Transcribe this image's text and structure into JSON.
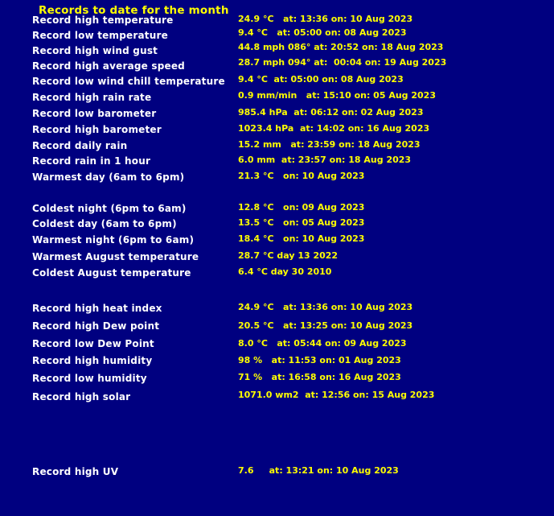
{
  "page": {
    "title": "Records to date for the month",
    "background_color": "#000080",
    "label_color": "#ffffff",
    "value_color": "#ffff00"
  },
  "records": [
    {
      "label": "Record high temperature",
      "value": "24.9 °C   at: 13:36 on: 10 Aug 2023"
    },
    {
      "label": "Record low temperature",
      "value": "9.4 °C   at: 05:00 on: 08 Aug 2023"
    },
    {
      "label": "Record high wind gust",
      "value": "44.8 mph 086° at: 20:52 on: 18 Aug 2023"
    },
    {
      "label": "Record high average speed",
      "value": "28.7 mph 094° at:  00:04 on: 19 Aug 2023"
    },
    {
      "label": "Record low wind chill temperature",
      "value": "9.4 °C  at: 05:00 on: 08 Aug 2023"
    },
    {
      "label": "Record high rain rate",
      "value": "0.9 mm/min   at: 15:10 on: 05 Aug 2023"
    },
    {
      "label": "Record low barometer",
      "value": "985.4 hPa  at: 06:12 on: 02 Aug 2023"
    },
    {
      "label": "Record high barometer",
      "value": "1023.4 hPa  at: 14:02 on: 16 Aug 2023"
    },
    {
      "label": "Record daily rain",
      "value": "15.2 mm   at: 23:59 on: 18 Aug 2023"
    },
    {
      "label": "Record rain in 1 hour",
      "value": "6.0 mm  at: 23:57 on: 18 Aug 2023"
    },
    {
      "label": "Warmest day (6am to 6pm)",
      "value": "21.3 °C   on: 10 Aug 2023"
    },
    {
      "label": "Coldest night (6pm to 6am)",
      "value": "12.8 °C   on: 09 Aug 2023"
    },
    {
      "label": "Coldest day (6am to 6pm)",
      "value": "13.5 °C   on: 05 Aug 2023"
    },
    {
      "label": "Warmest night (6pm to 6am)",
      "value": "18.4 °C   on: 10 Aug 2023"
    },
    {
      "label": "Warmest August temperature",
      "value": "28.7 °C day 13 2022"
    },
    {
      "label": "Coldest August temperature",
      "value": "6.4 °C day 30 2010"
    },
    {
      "label": "Record high heat index",
      "value": "24.9 °C   at: 13:36 on: 10 Aug 2023"
    },
    {
      "label": "Record high Dew point",
      "value": "20.5 °C   at: 13:25 on: 10 Aug 2023"
    },
    {
      "label": "Record low Dew Point",
      "value": "8.0 °C   at: 05:44 on: 09 Aug 2023"
    },
    {
      "label": "Record high humidity",
      "value": "98 %   at: 11:53 on: 01 Aug 2023"
    },
    {
      "label": "Record low humidity",
      "value": "71 %   at: 16:58 on: 16 Aug 2023"
    },
    {
      "label": "Record high solar",
      "value": "1071.0 wm2  at: 12:56 on: 15 Aug 2023"
    },
    {
      "label": "Record high UV",
      "value": "7.6     at: 13:21 on: 10 Aug 2023"
    }
  ]
}
